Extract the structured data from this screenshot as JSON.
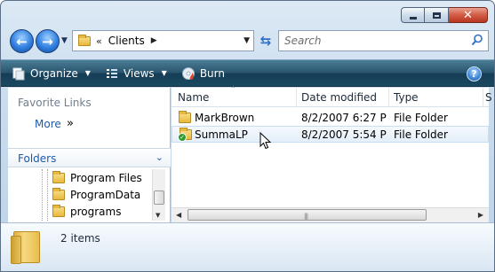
{
  "nav": {
    "address_chevrons": "«",
    "address_path": "Clients",
    "search_placeholder": "Search"
  },
  "toolbar": {
    "organize_label": "Organize",
    "views_label": "Views",
    "burn_label": "Burn",
    "help_label": "?"
  },
  "navpane": {
    "favorites_title": "Favorite Links",
    "more_label": "More",
    "more_arrows": "»",
    "folders_label": "Folders",
    "tree": [
      "Program Files",
      "ProgramData",
      "programs"
    ]
  },
  "filelist": {
    "columns": [
      "Name",
      "Date modified",
      "Type",
      "S"
    ],
    "rows": [
      {
        "name": "MarkBrown",
        "date": "8/2/2007 6:27 P",
        "type": "File Folder"
      },
      {
        "name": "SummaLP",
        "date": "8/2/2007 5:54 P",
        "type": "File Folder"
      }
    ]
  },
  "details": {
    "count": "2 items"
  },
  "colors": {
    "command_bar": "#1a4962",
    "link_blue": "#1e5aa8",
    "folder_yellow": "#e8b93c"
  }
}
